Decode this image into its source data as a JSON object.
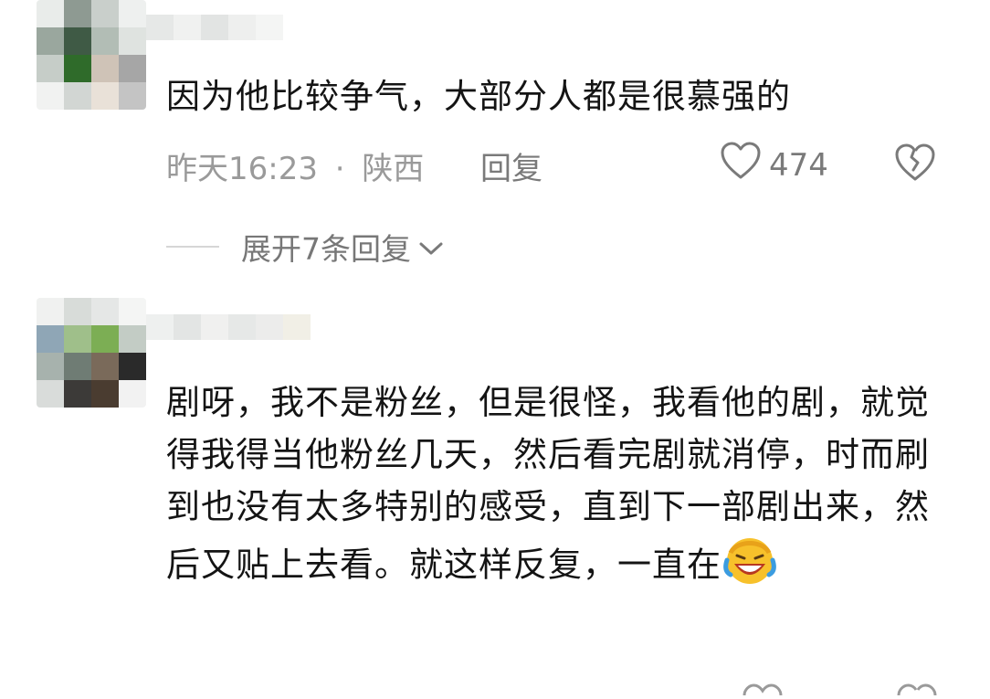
{
  "comments": [
    {
      "text": "因为他比较争气，大部分人都是很慕强的",
      "time": "昨天16:23",
      "separator": "·",
      "location": "陕西",
      "reply_label": "回复",
      "likes": "474",
      "expand_label": "展开7条回复"
    },
    {
      "text": "剧呀，我不是粉丝，但是很怪，我看他的剧，就觉得我得当他粉丝几天，然后看完剧就消停，时而刷到也没有太多特别的感受，直到下一部剧出来，然后又贴上去看。就这样反复，一直在",
      "emoji": "laughing-face-emoji"
    }
  ],
  "icons": {
    "like": "heart-outline-icon",
    "dislike": "broken-heart-icon",
    "expand": "chevron-down-icon"
  },
  "colors": {
    "text": "#141414",
    "meta": "#9a9a9a",
    "icon": "#7a7a7a",
    "divider": "#d6d6d6"
  }
}
